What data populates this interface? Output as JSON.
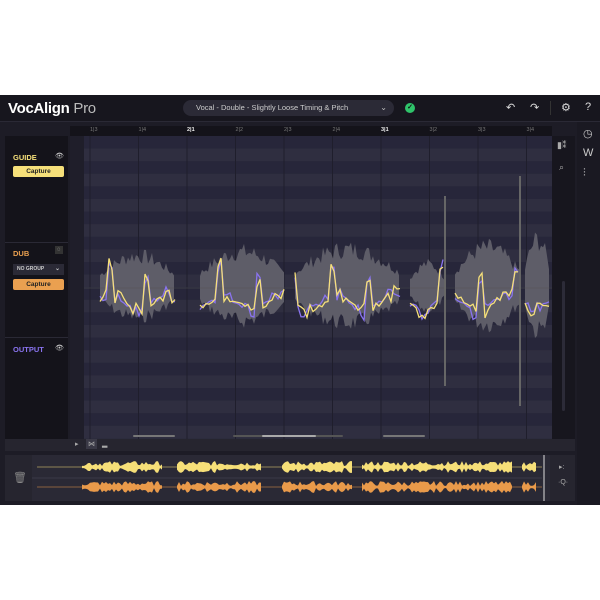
{
  "header": {
    "app_name": "VocAlign",
    "app_suffix": "Pro",
    "preset": "Vocal - Double - Slightly Loose Timing & Pitch",
    "status": "ok",
    "undo_icon": "undo-icon",
    "redo_icon": "redo-icon",
    "settings_icon": "gear-icon",
    "help": "?"
  },
  "ruler": {
    "ticks": [
      "1|3",
      "1|4",
      "2|1",
      "2|2",
      "2|3",
      "2|4",
      "3|1",
      "3|2",
      "3|3",
      "3|4"
    ],
    "major": [
      "2|1",
      "3|1"
    ]
  },
  "tracks": {
    "guide": {
      "label": "GUIDE",
      "button": "Capture",
      "color": "#f6e07a"
    },
    "dub": {
      "label": "DUB",
      "group": "NO GROUP",
      "button": "Capture",
      "color": "#eaa050"
    },
    "output": {
      "label": "OUTPUT",
      "color": "#8a74f0"
    }
  },
  "colors": {
    "guide_pitch": "#f6e07a",
    "dub_pitch": "#8a74f0",
    "waveform": "#5e5d68",
    "guide_overview": "#f6df78",
    "dub_overview": "#e99a4a"
  }
}
